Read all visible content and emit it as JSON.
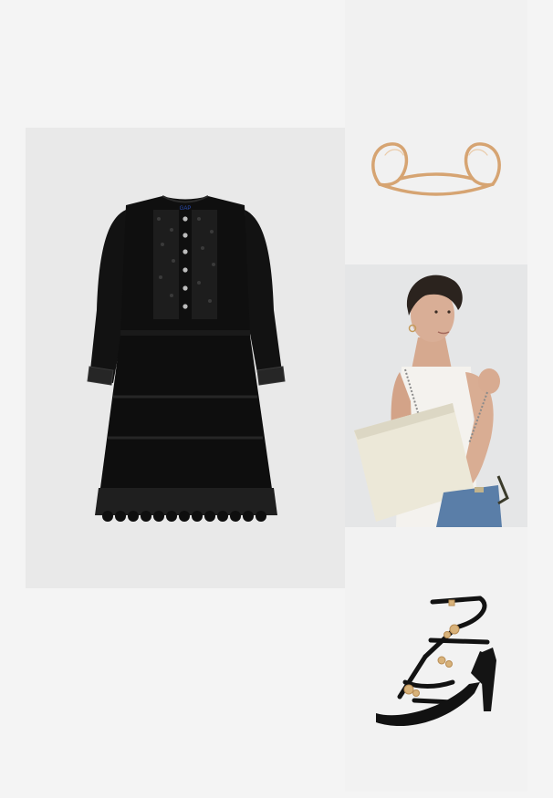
{
  "collage": {
    "background": "#f4f4f4",
    "items": [
      {
        "name": "dress",
        "color": "#0d0d0d",
        "label": "GAP"
      },
      {
        "name": "cuff-bracelet",
        "color": "#d9a878"
      },
      {
        "name": "model-with-bag",
        "bag_color": "#ece8d8"
      },
      {
        "name": "strappy-heel-sandal",
        "color": "#141414",
        "accent": "#d8b27a"
      }
    ]
  }
}
